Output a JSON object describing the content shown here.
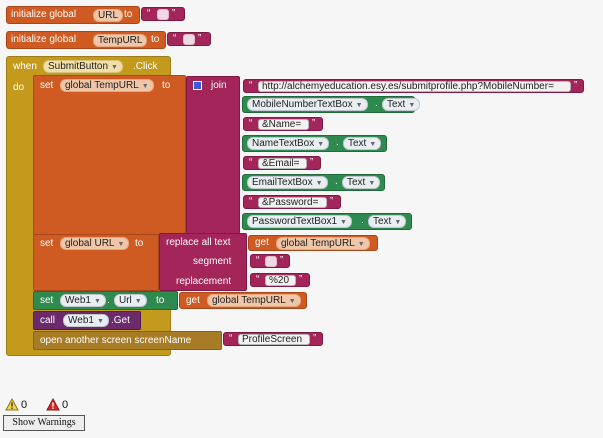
{
  "globals": [
    {
      "label": "initialize global",
      "name": "URL",
      "to": "to"
    },
    {
      "label": "initialize global",
      "name": "TempURL",
      "to": "to"
    }
  ],
  "event": {
    "when": "when",
    "component": "SubmitButton",
    "event": ".Click",
    "do": "do"
  },
  "set_temp": {
    "set": "set",
    "var": "global TempURL",
    "to": "to",
    "join": "join"
  },
  "join_items": [
    {
      "kind": "text",
      "value": "http://alchemyeducation.esy.es/submitprofile.php?MobileNumber="
    },
    {
      "kind": "prop",
      "component": "MobileNumberTextBox",
      "prop": "Text"
    },
    {
      "kind": "text",
      "value": "&Name="
    },
    {
      "kind": "prop",
      "component": "NameTextBox",
      "prop": "Text"
    },
    {
      "kind": "text",
      "value": "&Email="
    },
    {
      "kind": "prop",
      "component": "EmailTextBox",
      "prop": "Text"
    },
    {
      "kind": "text",
      "value": "&Password="
    },
    {
      "kind": "prop",
      "component": "PasswordTextBox1",
      "prop": "Text"
    }
  ],
  "set_url": {
    "set": "set",
    "var": "global URL",
    "to": "to",
    "replace_all": "replace all text",
    "get": "get",
    "get_var": "global TempURL",
    "segment": "segment",
    "replacement": "replacement",
    "replacement_value": "%20"
  },
  "set_web": {
    "set": "set",
    "component": "Web1",
    "prop": "Url",
    "to": "to",
    "get": "get",
    "get_var": "global TempURL"
  },
  "call_web": {
    "call": "call",
    "component": "Web1",
    "method": ".Get"
  },
  "open_screen": {
    "label": "open another screen  screenName",
    "value": "ProfileScreen"
  },
  "quote": "“",
  "quote_close": "”",
  "dot": ".",
  "warnings": {
    "warn_count": "0",
    "error_count": "0",
    "button": "Show Warnings"
  },
  "colors": {
    "global": "#d05b22",
    "event": "#c49a1c",
    "text": "#a4255a",
    "component": "#2e8a4e",
    "call": "#6b2a6b",
    "control": "#a87c27"
  }
}
